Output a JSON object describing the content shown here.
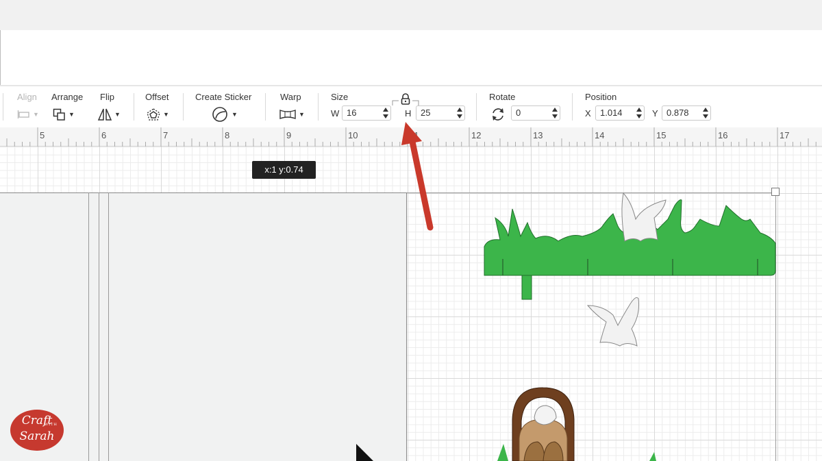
{
  "toolbar": {
    "align": {
      "label": "Align"
    },
    "arrange": {
      "label": "Arrange"
    },
    "flip": {
      "label": "Flip"
    },
    "offset": {
      "label": "Offset"
    },
    "create_sticker": {
      "label": "Create Sticker"
    },
    "warp": {
      "label": "Warp"
    },
    "size": {
      "label": "Size",
      "w_label": "W",
      "w_value": "16",
      "h_label": "H",
      "h_value": "25",
      "lock": "lock-icon"
    },
    "rotate": {
      "label": "Rotate",
      "value": "0"
    },
    "position": {
      "label": "Position",
      "x_label": "X",
      "x_value": "1.014",
      "y_label": "Y",
      "y_value": "0.878"
    }
  },
  "ruler": {
    "numbers": [
      "5",
      "6",
      "7",
      "8",
      "9",
      "10",
      "11",
      "12",
      "13",
      "14",
      "15",
      "16",
      "17"
    ]
  },
  "tooltip": {
    "text": "x:1 y:0.74"
  },
  "logo": {
    "line1": "Craft",
    "line2": "WITH",
    "line3": "Sarah"
  },
  "colors": {
    "grass": "#3cb54a",
    "arrow": "#c9392b",
    "basket": "#6e3f1f",
    "bunny": "#c49a6c"
  },
  "icons": [
    "align-icon",
    "arrange-icon",
    "flip-icon",
    "offset-icon",
    "sticker-icon",
    "warp-icon",
    "rotate-icon",
    "lock-icon"
  ]
}
